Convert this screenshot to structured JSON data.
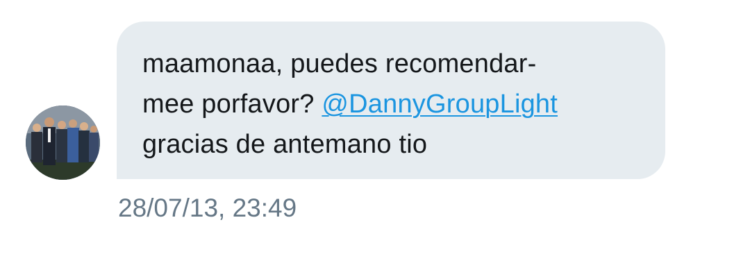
{
  "message": {
    "line1": "maamonaa, puedes recomendar-",
    "line2_text": "mee porfavor? ",
    "mention": "@DannyGroupLight",
    "line3": "gracias de antemano tio",
    "timestamp": "28/07/13, 23:49"
  },
  "colors": {
    "bubble_bg": "#e6ecf0",
    "text": "#14171a",
    "mention": "#1b95e0",
    "timestamp": "#657786"
  },
  "icons": {
    "avatar": "avatar-photo"
  }
}
